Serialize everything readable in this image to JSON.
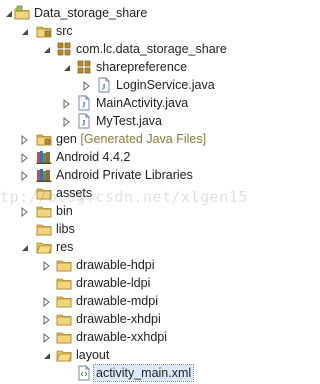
{
  "tree": {
    "items": [
      {
        "label": "Data_storage_share",
        "extra": ""
      },
      {
        "label": "src",
        "extra": ""
      },
      {
        "label": "com.lc.data_storage_share",
        "extra": ""
      },
      {
        "label": "sharepreference",
        "extra": ""
      },
      {
        "label": "LoginService.java",
        "extra": ""
      },
      {
        "label": "MainActivity.java",
        "extra": ""
      },
      {
        "label": "MyTest.java",
        "extra": ""
      },
      {
        "label": "gen",
        "extra": "[Generated Java Files]"
      },
      {
        "label": "Android 4.4.2",
        "extra": ""
      },
      {
        "label": "Android Private Libraries",
        "extra": ""
      },
      {
        "label": "assets",
        "extra": ""
      },
      {
        "label": "bin",
        "extra": ""
      },
      {
        "label": "libs",
        "extra": ""
      },
      {
        "label": "res",
        "extra": ""
      },
      {
        "label": "drawable-hdpi",
        "extra": ""
      },
      {
        "label": "drawable-ldpi",
        "extra": ""
      },
      {
        "label": "drawable-mdpi",
        "extra": ""
      },
      {
        "label": "drawable-xhdpi",
        "extra": ""
      },
      {
        "label": "drawable-xxhdpi",
        "extra": ""
      },
      {
        "label": "layout",
        "extra": ""
      },
      {
        "label": "activity_main.xml",
        "extra": ""
      }
    ]
  },
  "watermark": {
    "text": "tp://blog.csdn.net/xlgen15"
  },
  "colors": {
    "folder": "#e8c35a",
    "package": "#b78a2b",
    "java_file": "#3f6fb5",
    "library": "#8b6e3a",
    "selection": "#dcebfb"
  }
}
